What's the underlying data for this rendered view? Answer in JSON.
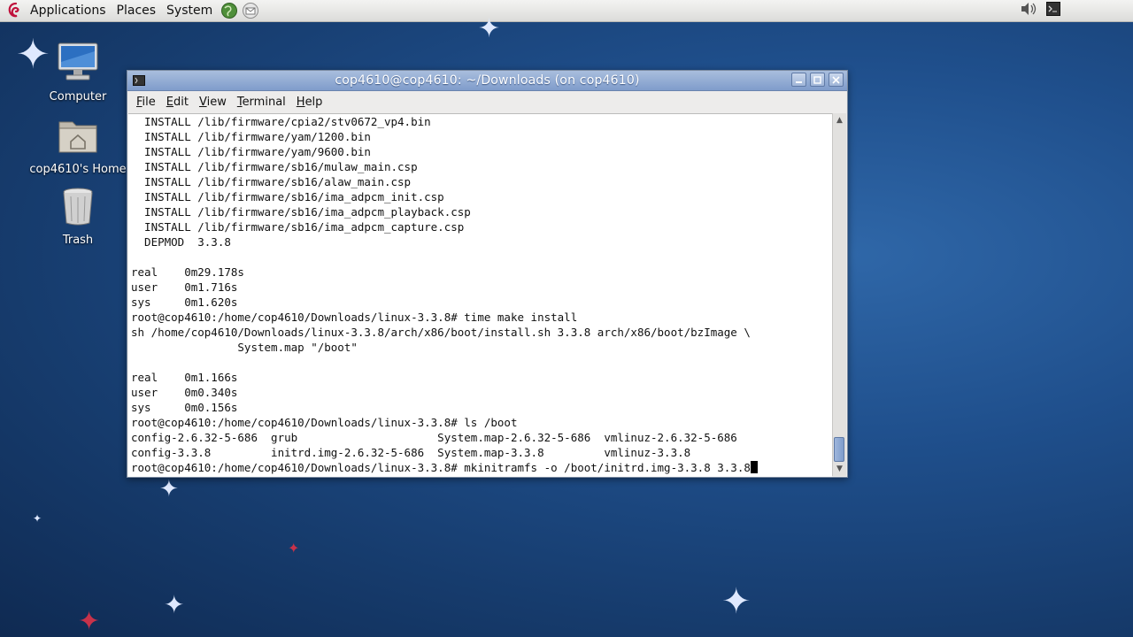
{
  "panel": {
    "menus": [
      "Applications",
      "Places",
      "System"
    ],
    "icons": [
      "debian-swirl-icon",
      "network-browser-icon",
      "mail-icon",
      "volume-icon",
      "terminal-applet-icon"
    ]
  },
  "desktop": {
    "icons": [
      {
        "label": "Computer",
        "icon": "computer-icon"
      },
      {
        "label": "cop4610's Home",
        "icon": "home-folder-icon"
      },
      {
        "label": "Trash",
        "icon": "trash-icon"
      }
    ]
  },
  "window": {
    "title": "cop4610@cop4610: ~/Downloads (on cop4610)",
    "menu": {
      "file": {
        "key": "F",
        "rest": "ile"
      },
      "edit": {
        "key": "E",
        "rest": "dit"
      },
      "view": {
        "key": "V",
        "rest": "iew"
      },
      "terminal": {
        "key": "T",
        "rest": "erminal"
      },
      "help": {
        "key": "H",
        "rest": "elp"
      }
    },
    "terminal_lines": [
      "  INSTALL /lib/firmware/cpia2/stv0672_vp4.bin",
      "  INSTALL /lib/firmware/yam/1200.bin",
      "  INSTALL /lib/firmware/yam/9600.bin",
      "  INSTALL /lib/firmware/sb16/mulaw_main.csp",
      "  INSTALL /lib/firmware/sb16/alaw_main.csp",
      "  INSTALL /lib/firmware/sb16/ima_adpcm_init.csp",
      "  INSTALL /lib/firmware/sb16/ima_adpcm_playback.csp",
      "  INSTALL /lib/firmware/sb16/ima_adpcm_capture.csp",
      "  DEPMOD  3.3.8",
      "",
      "real    0m29.178s",
      "user    0m1.716s",
      "sys     0m1.620s",
      "root@cop4610:/home/cop4610/Downloads/linux-3.3.8# time make install",
      "sh /home/cop4610/Downloads/linux-3.3.8/arch/x86/boot/install.sh 3.3.8 arch/x86/boot/bzImage \\",
      "                System.map \"/boot\"",
      "",
      "real    0m1.166s",
      "user    0m0.340s",
      "sys     0m0.156s",
      "root@cop4610:/home/cop4610/Downloads/linux-3.3.8# ls /boot",
      "config-2.6.32-5-686  grub                     System.map-2.6.32-5-686  vmlinuz-2.6.32-5-686",
      "config-3.3.8         initrd.img-2.6.32-5-686  System.map-3.3.8         vmlinuz-3.3.8"
    ],
    "prompt_line": "root@cop4610:/home/cop4610/Downloads/linux-3.3.8# mkinitramfs -o /boot/initrd.img-3.3.8 3.3.8"
  },
  "colors": {
    "desktop_bg": "#1f4f8c",
    "titlebar": "#8fa9d3",
    "panel": "#e8e8e6"
  }
}
